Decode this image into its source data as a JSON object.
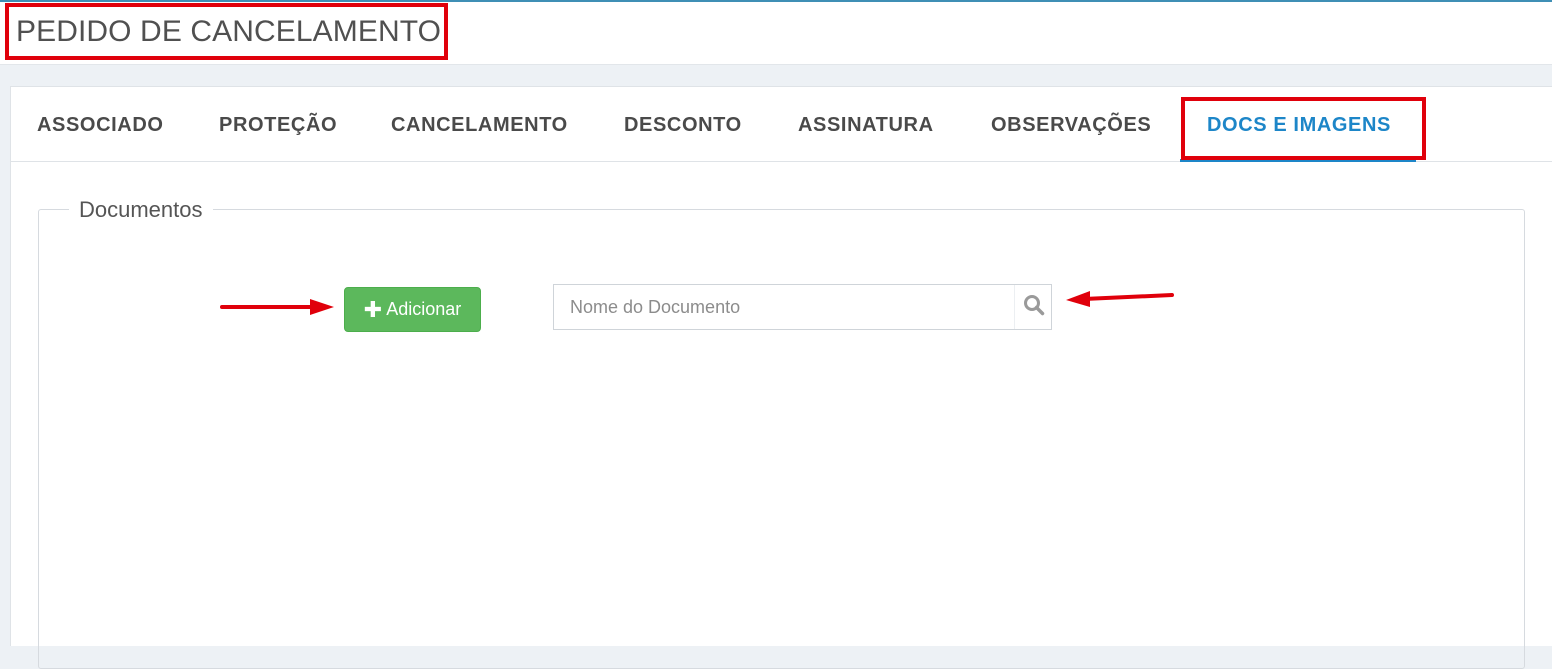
{
  "header": {
    "title": "PEDIDO DE CANCELAMENTO"
  },
  "tabs": [
    {
      "label": "ASSOCIADO",
      "active": false
    },
    {
      "label": "PROTEÇÃO",
      "active": false
    },
    {
      "label": "CANCELAMENTO",
      "active": false
    },
    {
      "label": "DESCONTO",
      "active": false
    },
    {
      "label": "ASSINATURA",
      "active": false
    },
    {
      "label": "OBSERVAÇÕES",
      "active": false
    },
    {
      "label": "DOCS E IMAGENS",
      "active": true
    }
  ],
  "documents": {
    "legend": "Documentos",
    "add_button": {
      "label": "Adicionar",
      "icon": "plus-icon"
    },
    "search": {
      "placeholder": "Nome do Documento",
      "value": "",
      "icon": "search-icon"
    }
  },
  "colors": {
    "accent": "#1d86c8",
    "success": "#5cb85c",
    "highlight": "#e0000b"
  }
}
